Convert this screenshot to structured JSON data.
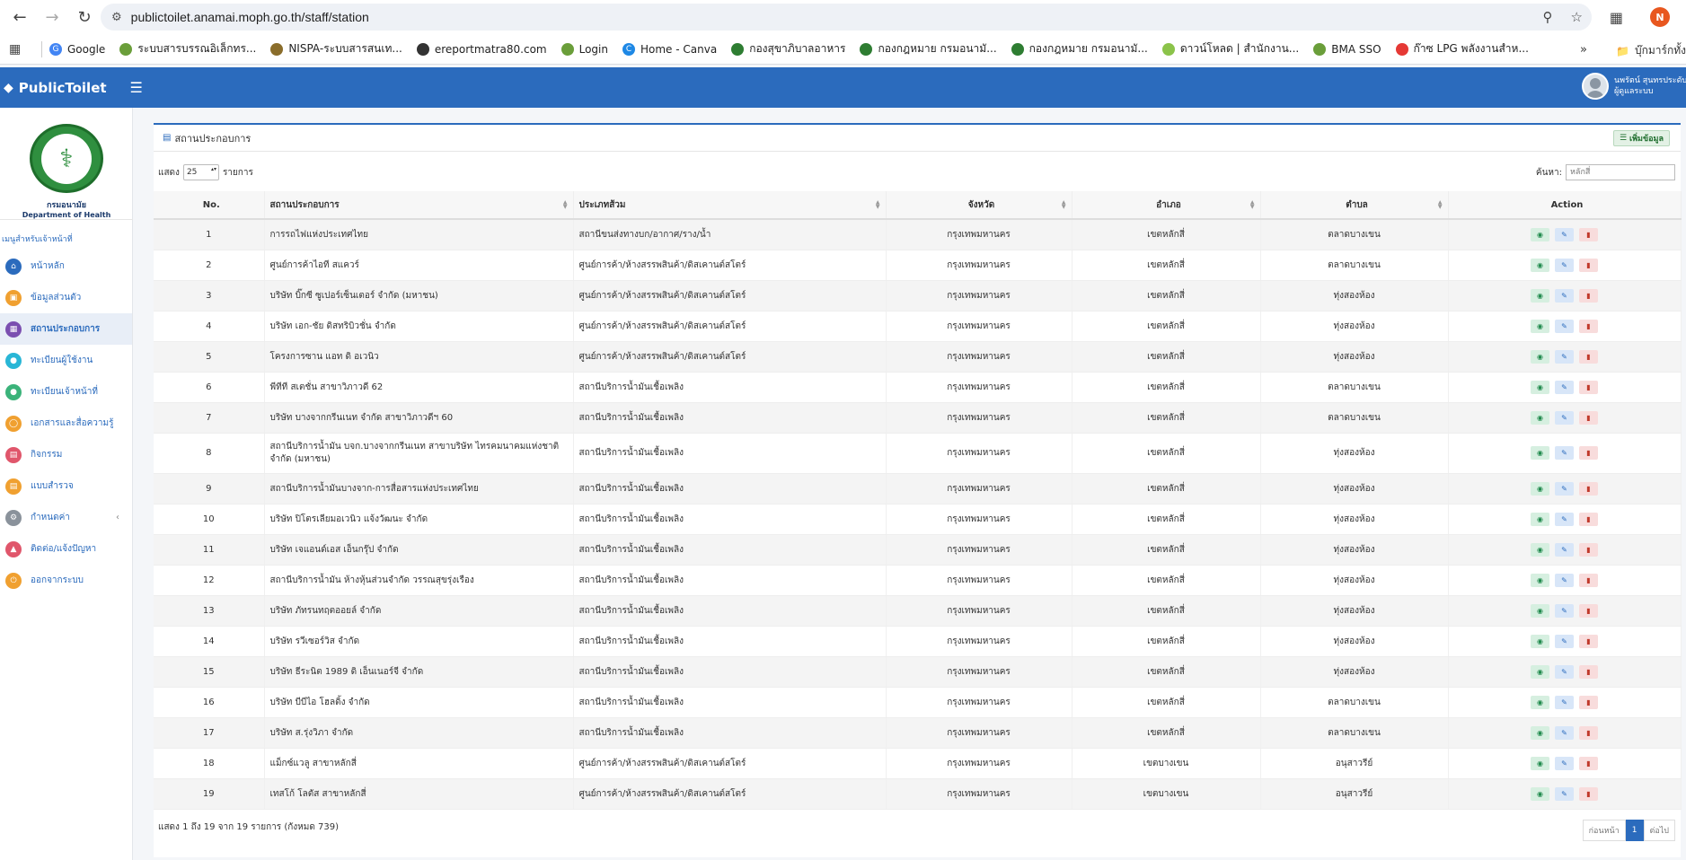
{
  "browser": {
    "url": "publictoilet.anamai.moph.go.th/staff/station",
    "profile_initial": "N",
    "bookmarks": [
      {
        "label": "Google",
        "color": "#4285f4"
      },
      {
        "label": "ระบบสารบรรณอิเล็กทร...",
        "color": "#6a9e3a"
      },
      {
        "label": "NISPA-ระบบสารสนเท...",
        "color": "#8a6d2b"
      },
      {
        "label": "ereportmatra80.com",
        "color": "#333333"
      },
      {
        "label": "Login",
        "color": "#6a9e3a"
      },
      {
        "label": "Home - Canva",
        "color": "#1e88e5"
      },
      {
        "label": "กองสุขาภิบาลอาหาร",
        "color": "#2e7d32"
      },
      {
        "label": "กองกฎหมาย กรมอนามั...",
        "color": "#2e7d32"
      },
      {
        "label": "กองกฎหมาย กรมอนามั...",
        "color": "#2e7d32"
      },
      {
        "label": "ดาวน์โหลด | สำนักงาน...",
        "color": "#8bc34a"
      },
      {
        "label": "BMA SSO",
        "color": "#6a9e3a"
      },
      {
        "label": "ก๊าซ LPG พลังงานสำห...",
        "color": "#e53935"
      }
    ],
    "bookmarks_more": "»",
    "bookmarks_folder": "บุ๊กมาร์กทั้ง"
  },
  "app": {
    "brand": "PublicToilet",
    "user_name": "นพรัตน์ สุนทรประดับฐี",
    "user_role": "ผู้ดูแลระบบ"
  },
  "sidebar": {
    "dept_th": "กรมอนามัย",
    "dept_en": "Department of Health",
    "caption": "เมนูสำหรับเจ้าหน้าที่",
    "items": [
      {
        "label": "หน้าหลัก",
        "icon": "home-icon",
        "color": "#2b6bbd"
      },
      {
        "label": "ข้อมูลส่วนตัว",
        "icon": "id-card-icon",
        "color": "#f0a030"
      },
      {
        "label": "สถานประกอบการ",
        "icon": "building-icon",
        "color": "#7b4fb0"
      },
      {
        "label": "ทะเบียนผู้ใช้งาน",
        "icon": "user-icon",
        "color": "#29b6d6"
      },
      {
        "label": "ทะเบียนเจ้าหน้าที่",
        "icon": "users-icon",
        "color": "#3bb37a"
      },
      {
        "label": "เอกสารและสื่อความรู้",
        "icon": "lightbulb-icon",
        "color": "#f0a030"
      },
      {
        "label": "กิจกรรม",
        "icon": "calendar-icon",
        "color": "#e0566b"
      },
      {
        "label": "แบบสำรวจ",
        "icon": "survey-icon",
        "color": "#f0a030"
      },
      {
        "label": "กำหนดค่า",
        "icon": "gear-icon",
        "color": "#8a929b"
      },
      {
        "label": "ติดต่อ/แจ้งปัญหา",
        "icon": "megaphone-icon",
        "color": "#e0566b"
      },
      {
        "label": "ออกจากระบบ",
        "icon": "power-icon",
        "color": "#f0a030"
      }
    ]
  },
  "card": {
    "title": "สถานประกอบการ",
    "add_label": "เพิ่มข้อมูล",
    "show_label": "แสดง",
    "show_value": "25",
    "records_label": "รายการ",
    "search_label": "ค้นหา:",
    "search_placeholder": "หลักสี่",
    "columns": [
      "No.",
      "สถานประกอบการ",
      "ประเภทส้วม",
      "จังหวัด",
      "อำเภอ",
      "ตำบล",
      "Action"
    ],
    "rows": [
      {
        "no": "1",
        "name": "การรถไฟแห่งประเทศไทย",
        "type": "สถานีขนส่งทางบก/อากาศ/ราง/น้ำ",
        "province": "กรุงเทพมหานคร",
        "district": "เขตหลักสี่",
        "subdistrict": "ตลาดบางเขน"
      },
      {
        "no": "2",
        "name": "ศูนย์การค้าไอที สแควร์",
        "type": "ศูนย์การค้า/ห้างสรรพสินค้า/ดิสเคานต์สโตร์",
        "province": "กรุงเทพมหานคร",
        "district": "เขตหลักสี่",
        "subdistrict": "ตลาดบางเขน"
      },
      {
        "no": "3",
        "name": "บริษัท บิ๊กซี ซูเปอร์เซ็นเตอร์ จำกัด (มหาชน)",
        "type": "ศูนย์การค้า/ห้างสรรพสินค้า/ดิสเคานต์สโตร์",
        "province": "กรุงเทพมหานคร",
        "district": "เขตหลักสี่",
        "subdistrict": "ทุ่งสองห้อง"
      },
      {
        "no": "4",
        "name": "บริษัท เอก-ชัย ดิสทริบิวชั่น จำกัด",
        "type": "ศูนย์การค้า/ห้างสรรพสินค้า/ดิสเคานต์สโตร์",
        "province": "กรุงเทพมหานคร",
        "district": "เขตหลักสี่",
        "subdistrict": "ทุ่งสองห้อง"
      },
      {
        "no": "5",
        "name": "โครงการซาน แอท ดิ อเวนิว",
        "type": "ศูนย์การค้า/ห้างสรรพสินค้า/ดิสเคานต์สโตร์",
        "province": "กรุงเทพมหานคร",
        "district": "เขตหลักสี่",
        "subdistrict": "ทุ่งสองห้อง"
      },
      {
        "no": "6",
        "name": "พีทีที สเตชั่น สาขาวิภาวดี 62",
        "type": "สถานีบริการน้ำมันเชื้อเพลิง",
        "province": "กรุงเทพมหานคร",
        "district": "เขตหลักสี่",
        "subdistrict": "ตลาดบางเขน"
      },
      {
        "no": "7",
        "name": "บริษัท บางจากกรีนเนท จำกัด สาขาวิภาวดีฯ 60",
        "type": "สถานีบริการน้ำมันเชื้อเพลิง",
        "province": "กรุงเทพมหานคร",
        "district": "เขตหลักสี่",
        "subdistrict": "ตลาดบางเขน"
      },
      {
        "no": "8",
        "name": "สถานีบริการน้ำมัน บจก.บางจากกรีนเนท สาขาบริษัท ไทรคมนาคมแห่งชาติ จำกัด (มหาชน)",
        "type": "สถานีบริการน้ำมันเชื้อเพลิง",
        "province": "กรุงเทพมหานคร",
        "district": "เขตหลักสี่",
        "subdistrict": "ทุ่งสองห้อง"
      },
      {
        "no": "9",
        "name": "สถานีบริการน้ำมันบางจาก-การสื่อสารแห่งประเทศไทย",
        "type": "สถานีบริการน้ำมันเชื้อเพลิง",
        "province": "กรุงเทพมหานคร",
        "district": "เขตหลักสี่",
        "subdistrict": "ทุ่งสองห้อง"
      },
      {
        "no": "10",
        "name": "บริษัท ปิโตรเลียมอเวนิว แจ้งวัฒนะ จำกัด",
        "type": "สถานีบริการน้ำมันเชื้อเพลิง",
        "province": "กรุงเทพมหานคร",
        "district": "เขตหลักสี่",
        "subdistrict": "ทุ่งสองห้อง"
      },
      {
        "no": "11",
        "name": "บริษัท เจแอนด์เอส เอ็นกรุ๊ป จำกัด",
        "type": "สถานีบริการน้ำมันเชื้อเพลิง",
        "province": "กรุงเทพมหานคร",
        "district": "เขตหลักสี่",
        "subdistrict": "ทุ่งสองห้อง"
      },
      {
        "no": "12",
        "name": "สถานีบริการน้ำมัน ห้างหุ้นส่วนจำกัด วรรณสุขรุ่งเรือง",
        "type": "สถานีบริการน้ำมันเชื้อเพลิง",
        "province": "กรุงเทพมหานคร",
        "district": "เขตหลักสี่",
        "subdistrict": "ทุ่งสองห้อง"
      },
      {
        "no": "13",
        "name": "บริษัท ภัทรนทฤตออยล์ จำกัด",
        "type": "สถานีบริการน้ำมันเชื้อเพลิง",
        "province": "กรุงเทพมหานคร",
        "district": "เขตหลักสี่",
        "subdistrict": "ทุ่งสองห้อง"
      },
      {
        "no": "14",
        "name": "บริษัท รวีเซอร์วิส จำกัด",
        "type": "สถานีบริการน้ำมันเชื้อเพลิง",
        "province": "กรุงเทพมหานคร",
        "district": "เขตหลักสี่",
        "subdistrict": "ทุ่งสองห้อง"
      },
      {
        "no": "15",
        "name": "บริษัท ธีระนิต 1989 ดิ เอ็นเนอร์จี จำกัด",
        "type": "สถานีบริการน้ำมันเชื้อเพลิง",
        "province": "กรุงเทพมหานคร",
        "district": "เขตหลักสี่",
        "subdistrict": "ทุ่งสองห้อง"
      },
      {
        "no": "16",
        "name": "บริษัท บีบีไอ โฮลดิ้ง จำกัด",
        "type": "สถานีบริการน้ำมันเชื้อเพลิง",
        "province": "กรุงเทพมหานคร",
        "district": "เขตหลักสี่",
        "subdistrict": "ตลาดบางเขน"
      },
      {
        "no": "17",
        "name": "บริษัท ส.รุ่งวิภา จำกัด",
        "type": "สถานีบริการน้ำมันเชื้อเพลิง",
        "province": "กรุงเทพมหานคร",
        "district": "เขตหลักสี่",
        "subdistrict": "ตลาดบางเขน"
      },
      {
        "no": "18",
        "name": "แม็กซ์แวลู สาขาหลักสี่",
        "type": "ศูนย์การค้า/ห้างสรรพสินค้า/ดิสเคานต์สโตร์",
        "province": "กรุงเทพมหานคร",
        "district": "เขตบางเขน",
        "subdistrict": "อนุสาวรีย์"
      },
      {
        "no": "19",
        "name": "เทสโก้ โลตัส สาขาหลักสี่",
        "type": "ศูนย์การค้า/ห้างสรรพสินค้า/ดิสเคานต์สโตร์",
        "province": "กรุงเทพมหานคร",
        "district": "เขตบางเขน",
        "subdistrict": "อนุสาวรีย์"
      }
    ],
    "footer_info": "แสดง 1 ถึง 19 จาก 19 รายการ (กังหมด 739)",
    "pager": {
      "prev": "ก่อนหน้า",
      "current": "1",
      "next": "ต่อไป"
    }
  }
}
